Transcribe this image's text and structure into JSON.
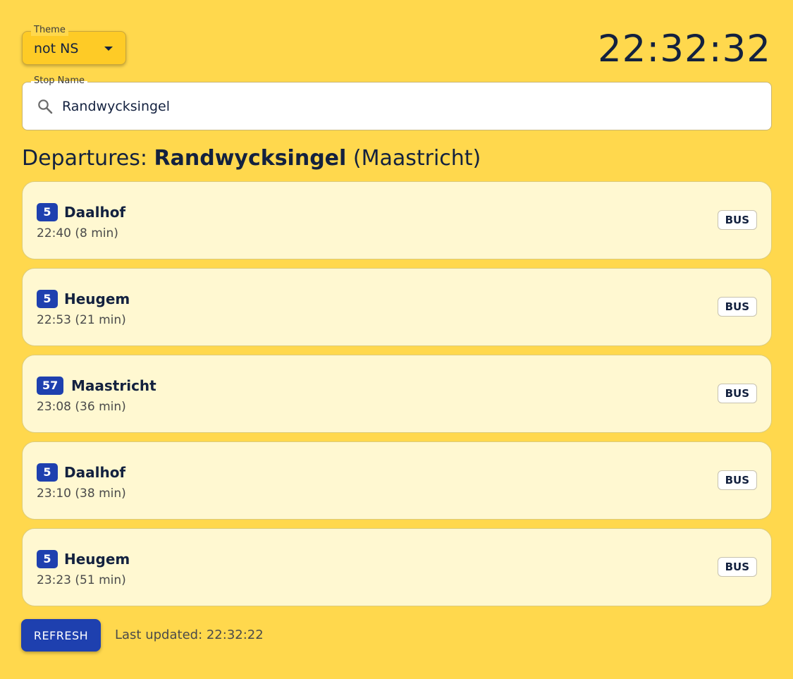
{
  "theme": {
    "label": "Theme",
    "value": "not NS"
  },
  "clock": "22:32:32",
  "stop": {
    "label": "Stop Name",
    "value": "Randwycksingel"
  },
  "heading": {
    "prefix": "Departures:",
    "stop": "Randwycksingel",
    "city": "(Maastricht)"
  },
  "departures": [
    {
      "line": "5",
      "destination": "Daalhof",
      "time": "22:40 (8 min)",
      "mode": "BUS"
    },
    {
      "line": "5",
      "destination": "Heugem",
      "time": "22:53 (21 min)",
      "mode": "BUS"
    },
    {
      "line": "57",
      "destination": "Maastricht",
      "time": "23:08 (36 min)",
      "mode": "BUS"
    },
    {
      "line": "5",
      "destination": "Daalhof",
      "time": "23:10 (38 min)",
      "mode": "BUS"
    },
    {
      "line": "5",
      "destination": "Heugem",
      "time": "23:23 (51 min)",
      "mode": "BUS"
    }
  ],
  "footer": {
    "refresh_label": "REFRESH",
    "last_updated": "Last updated: 22:32:22"
  },
  "colors": {
    "background": "#ffd84d",
    "accent": "#1e40af",
    "card": "#fff8d1"
  },
  "icons": {
    "search": "search-icon",
    "dropdown": "chevron-down-icon"
  }
}
